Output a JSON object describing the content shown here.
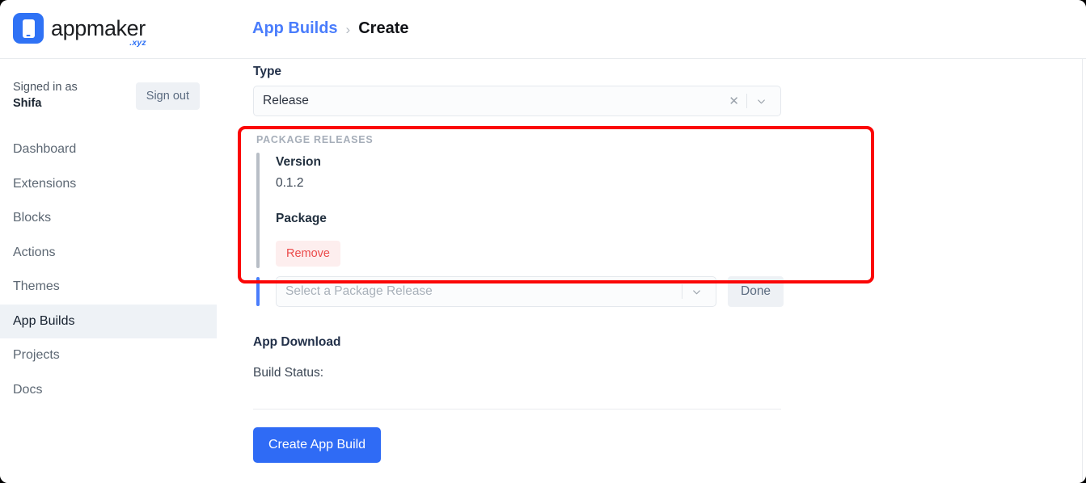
{
  "brand": {
    "name": "appmaker",
    "tld": ".xyz",
    "icon": "phone-icon",
    "accent": "#2f72f5"
  },
  "breadcrumb": {
    "parent": "App Builds",
    "separator": "›",
    "current": "Create"
  },
  "sidebar": {
    "signed_in_label": "Signed in as",
    "user_name": "Shifa",
    "sign_out_label": "Sign out",
    "items": [
      {
        "label": "Dashboard",
        "active": false
      },
      {
        "label": "Extensions",
        "active": false
      },
      {
        "label": "Blocks",
        "active": false
      },
      {
        "label": "Actions",
        "active": false
      },
      {
        "label": "Themes",
        "active": false
      },
      {
        "label": "App Builds",
        "active": true
      },
      {
        "label": "Projects",
        "active": false
      },
      {
        "label": "Docs",
        "active": false
      }
    ]
  },
  "form": {
    "type_label": "Type",
    "type_value": "Release",
    "clear_icon": "✕",
    "package_releases_title": "PACKAGE RELEASES",
    "release": {
      "version_label": "Version",
      "version_value": "0.1.2",
      "package_label": "Package",
      "package_value": "",
      "remove_label": "Remove"
    },
    "picker_placeholder": "Select a Package Release",
    "done_label": "Done",
    "app_download_label": "App Download",
    "build_status_label": "Build Status:",
    "submit_label": "Create App Build"
  },
  "annotation": {
    "color": "#fb0606",
    "target": "package-releases-section"
  }
}
